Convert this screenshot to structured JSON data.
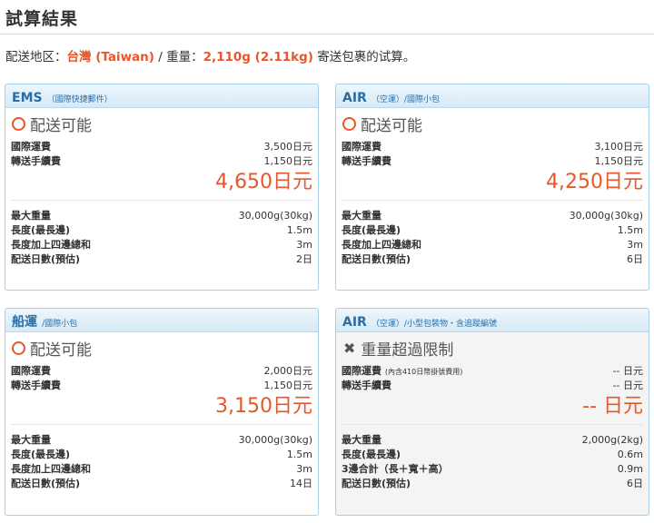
{
  "page_title": "試算結果",
  "summary": {
    "prefix": "配送地区：",
    "region": "台灣 (Taiwan)",
    "weight_label": " / 重量：",
    "weight": "2,110g (2.11kg)",
    "suffix": " 寄送包裹的试算。"
  },
  "colors": {
    "accent": "#e8572a",
    "header_text": "#2b6ea6",
    "border": "#a9cfe8"
  },
  "cards": [
    {
      "name": "EMS",
      "sub": "（國際快捷郵件）",
      "status_icon": "circle-icon",
      "status": "配送可能",
      "fee_rows": [
        {
          "label": "國際運費",
          "note": "",
          "value": "3,500日元"
        },
        {
          "label": "轉送手續費",
          "note": "",
          "value": "1,150日元"
        }
      ],
      "total": "4,650日元",
      "spec_rows": [
        {
          "label": "最大重量",
          "value": "30,000g(30kg)"
        },
        {
          "label": "長度(最長邊)",
          "value": "1.5m"
        },
        {
          "label": "長度加上四邊總和",
          "value": "3m"
        },
        {
          "label": "配送日數(預估)",
          "value": "2日"
        }
      ]
    },
    {
      "name": "AIR",
      "sub": "（空運）/國際小包",
      "status_icon": "circle-icon",
      "status": "配送可能",
      "fee_rows": [
        {
          "label": "國際運費",
          "note": "",
          "value": "3,100日元"
        },
        {
          "label": "轉送手續費",
          "note": "",
          "value": "1,150日元"
        }
      ],
      "total": "4,250日元",
      "spec_rows": [
        {
          "label": "最大重量",
          "value": "30,000g(30kg)"
        },
        {
          "label": "長度(最長邊)",
          "value": "1.5m"
        },
        {
          "label": "長度加上四邊總和",
          "value": "3m"
        },
        {
          "label": "配送日數(預估)",
          "value": "6日"
        }
      ]
    },
    {
      "name": "船運",
      "sub": "/國際小包",
      "status_icon": "circle-icon",
      "status": "配送可能",
      "fee_rows": [
        {
          "label": "國際運費",
          "note": "",
          "value": "2,000日元"
        },
        {
          "label": "轉送手續費",
          "note": "",
          "value": "1,150日元"
        }
      ],
      "total": "3,150日元",
      "spec_rows": [
        {
          "label": "最大重量",
          "value": "30,000g(30kg)"
        },
        {
          "label": "長度(最長邊)",
          "value": "1.5m"
        },
        {
          "label": "長度加上四邊總和",
          "value": "3m"
        },
        {
          "label": "配送日數(預估)",
          "value": "14日"
        }
      ]
    },
    {
      "name": "AIR",
      "sub": "（空運）/小型包裝物・含追蹤編號",
      "status_icon": "cross-icon",
      "status": "重量超過限制",
      "fee_rows": [
        {
          "label": "國際運費",
          "note": "(內含410日幣掛號費用)",
          "value": "-- 日元"
        },
        {
          "label": "轉送手續費",
          "note": "",
          "value": "-- 日元"
        }
      ],
      "total": "-- 日元",
      "spec_rows": [
        {
          "label": "最大重量",
          "value": "2,000g(2kg)"
        },
        {
          "label": "長度(最長邊)",
          "value": "0.6m"
        },
        {
          "label": "3邊合計（長＋寬＋高）",
          "value": "0.9m"
        },
        {
          "label": "配送日數(預估)",
          "value": "6日"
        }
      ]
    }
  ]
}
